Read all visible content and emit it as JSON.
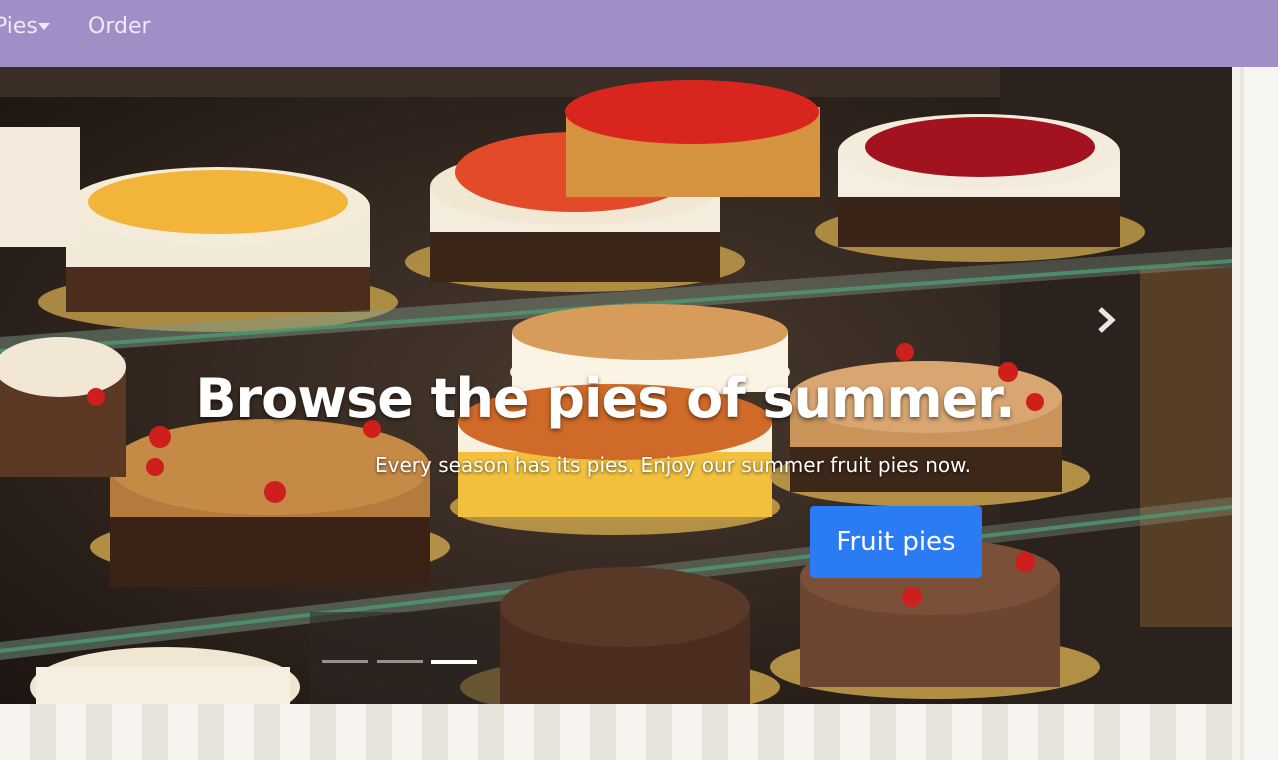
{
  "nav": {
    "items": [
      {
        "label": "Pies",
        "has_dropdown": true
      },
      {
        "label": "Order",
        "has_dropdown": false
      }
    ]
  },
  "carousel": {
    "title": "Browse the pies of summer.",
    "text": "Every season has its pies. Enjoy our summer fruit pies now.",
    "cta_label": "Fruit pies",
    "indicator_count": 3,
    "active_indicator": 3
  },
  "colors": {
    "navbar": "#a08fc6",
    "cta": "#2b7bf5"
  }
}
